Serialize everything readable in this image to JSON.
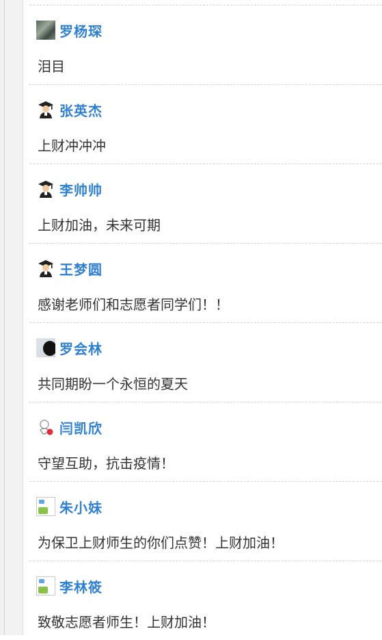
{
  "comments": [
    {
      "name": "罗杨琛",
      "text": "泪目",
      "avatar_icon": "landscape-photo-avatar"
    },
    {
      "name": "张英杰",
      "text": "上财冲冲冲",
      "avatar_icon": "graduate-icon"
    },
    {
      "name": "李帅帅",
      "text": "上财加油，未来可期",
      "avatar_icon": "graduate-icon"
    },
    {
      "name": "王梦圆",
      "text": "感谢老师们和志愿者同学们！！",
      "avatar_icon": "graduate-icon"
    },
    {
      "name": "罗会林",
      "text": "共同期盼一个永恒的夏天",
      "avatar_icon": "portrait-photo-avatar"
    },
    {
      "name": "闫凯欣",
      "text": "守望互助，抗击疫情！",
      "avatar_icon": "sketch-avatar"
    },
    {
      "name": "朱小妹",
      "text": "为保卫上财师生的你们点赞！上财加油！",
      "avatar_icon": "broken-image-icon"
    },
    {
      "name": "李林筱",
      "text": "致敬志愿者师生！上财加油！",
      "avatar_icon": "broken-image-icon"
    }
  ],
  "colors": {
    "name": "#2f80d1",
    "text": "#333333",
    "divider": "#d2d2d2"
  }
}
